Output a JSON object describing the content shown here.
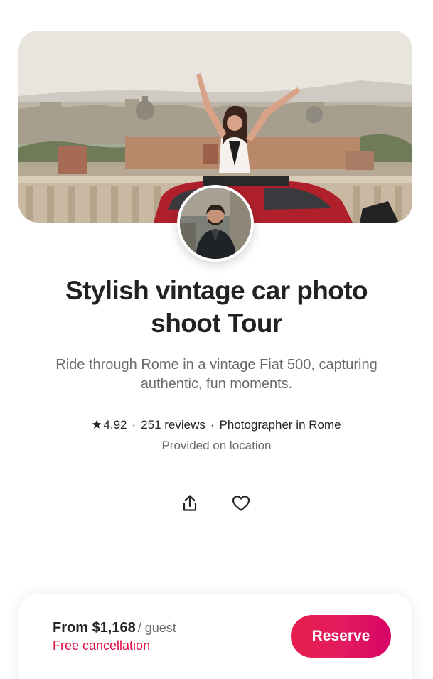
{
  "experience": {
    "title": "Stylish vintage car photo shoot Tour",
    "description": "Ride through Rome in a vintage Fiat 500, capturing authentic, fun moments.",
    "rating": "4.92",
    "reviews": "251 reviews",
    "host_role": "Photographer in Rome",
    "location_note": "Provided on location",
    "separator": "·"
  },
  "actions": {
    "share_icon": "share-icon",
    "save_icon": "heart-icon"
  },
  "booking": {
    "price_prefix": "From",
    "price": "$1,168",
    "price_unit": "/ guest",
    "cancellation": "Free cancellation",
    "reserve_label": "Reserve"
  },
  "colors": {
    "brand": "#e31c5f",
    "text_primary": "#222222",
    "text_secondary": "#6a6a6a"
  }
}
